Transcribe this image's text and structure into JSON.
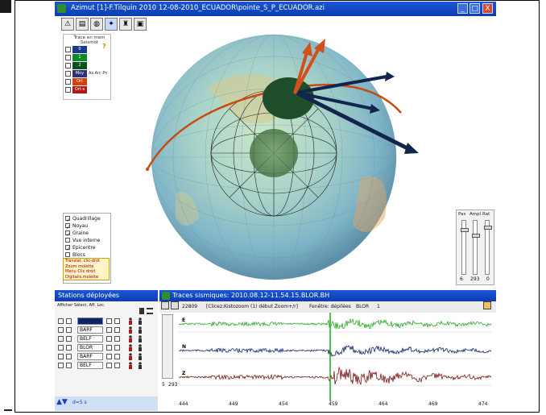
{
  "window": {
    "title": "Azimut [1]-F.Tilquin 2010 12-08-2010_ECUADOR\\pointe_S_P_ECUADOR.azi",
    "minimize": "_",
    "maximize": "□",
    "close": "X"
  },
  "toolbar": {
    "buttons": [
      "warning-icon",
      "book-icon",
      "globe-icon",
      "satellite-icon",
      "station-icon",
      "settings-icon"
    ]
  },
  "legend": {
    "title": "Trace en mem Seismot",
    "help": "?",
    "rows": [
      {
        "label": "0",
        "color": "#1b3a8f",
        "text": ""
      },
      {
        "label": "1",
        "color": "#0f8a2a",
        "text": ""
      },
      {
        "label": "2",
        "color": "#0b4f1a",
        "text": ""
      },
      {
        "label": "3",
        "color": "#2f2f7a",
        "text": "Moy"
      },
      {
        "label": "4",
        "color": "#d04010",
        "text": "Ort"
      },
      {
        "label": "5",
        "color": "#b01818",
        "text": "Ort-s"
      }
    ],
    "aside": "Az Arc Pn"
  },
  "options": [
    {
      "label": "Quadrillage",
      "checked": true
    },
    {
      "label": "Noyau",
      "checked": true
    },
    {
      "label": "Graine",
      "checked": true
    },
    {
      "label": "Vue interne",
      "checked": false
    },
    {
      "label": "Epicentre",
      "checked": true
    },
    {
      "label": "Blocs",
      "checked": false
    }
  ],
  "help_text": [
    "Translat. clic-drot",
    "Zoom molette",
    "Menu Clic droit",
    "Digitalis.molette"
  ],
  "sliders": {
    "labels": [
      "Pas",
      "Ampl",
      "Rat"
    ],
    "values": [
      "6",
      "293",
      "0"
    ],
    "levels": [
      0.15,
      0.25,
      0.1
    ]
  },
  "stations": {
    "title": "Stations déployées",
    "header": "Afficher Sélect.  Aff. Loc.",
    "rows": [
      {
        "name": "",
        "selected": true
      },
      {
        "name": "BARF",
        "selected": false
      },
      {
        "name": "BELF",
        "selected": false
      },
      {
        "name": "BLOR",
        "selected": false
      },
      {
        "name": "BARF",
        "selected": false
      },
      {
        "name": "BELF",
        "selected": false
      }
    ]
  },
  "traces": {
    "title": "Traces sismiques: 2010.08.12-11.54.15.BLOR.BH",
    "bar": {
      "count": "22809",
      "info": "[Clicez:Kistozoom (1) début Zoom+/r]",
      "window": "Fenêtre: dépilées",
      "station": "BLOR",
      "channel": "1"
    },
    "channels": [
      "E",
      "N",
      "Z"
    ],
    "channel_colors": [
      "#2eaa2e",
      "#1a2a6a",
      "#7a1a1a"
    ],
    "marker_color": "#1aaa1a",
    "ticks": [
      "444",
      "449",
      "454",
      "459",
      "464",
      "469",
      "474"
    ],
    "left_values": [
      "5",
      "293"
    ],
    "footer": "d=5 s"
  }
}
